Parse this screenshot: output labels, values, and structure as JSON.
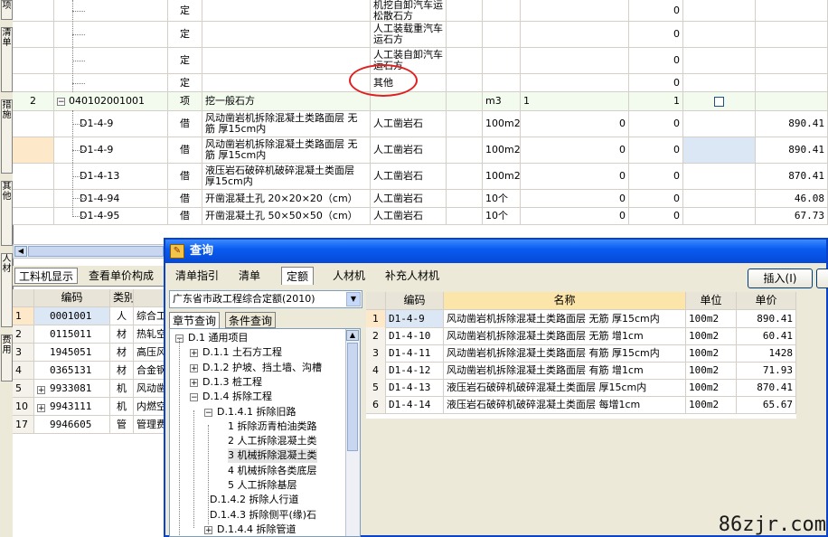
{
  "left_strip": {
    "tabs": [
      "项",
      "清",
      "单",
      "措",
      "施",
      "项",
      "目",
      "其",
      "他",
      "项",
      "目",
      "人",
      "材",
      "机",
      "汇",
      "总",
      "费",
      "用"
    ]
  },
  "main_grid": {
    "rows": [
      {
        "code": "",
        "type": "定",
        "name": "",
        "content": "机挖自卸汽车运松散石方",
        "unit": "",
        "qty": "",
        "c7": "",
        "c8": "0",
        "price": ""
      },
      {
        "code": "",
        "type": "定",
        "name": "",
        "content": "人工装载重汽车运石方",
        "unit": "",
        "qty": "",
        "c7": "",
        "c8": "0",
        "price": ""
      },
      {
        "code": "",
        "type": "定",
        "name": "",
        "content": "人工装自卸汽车运石方",
        "unit": "",
        "qty": "",
        "c7": "",
        "c8": "0",
        "price": ""
      },
      {
        "code": "",
        "type": "定",
        "name": "",
        "content": "其他",
        "unit": "",
        "qty": "",
        "c7": "",
        "c8": "0",
        "price": ""
      },
      {
        "no": "2",
        "code": "040102001001",
        "type": "项",
        "name": "挖一般石方",
        "content": "",
        "unit": "m3",
        "qty": "1",
        "c7": "",
        "c8": "1",
        "price": ""
      },
      {
        "code": "D1-4-9",
        "type": "借",
        "name": "风动凿岩机拆除混凝土类路面层 无筋 厚15cm内",
        "content": "人工凿岩石",
        "unit": "100m2",
        "qty": "",
        "c7": "0",
        "c8": "0",
        "price": "890.41"
      },
      {
        "code": "D1-4-9",
        "type": "借",
        "name": "风动凿岩机拆除混凝土类路面层 无筋 厚15cm内",
        "content": "人工凿岩石",
        "unit": "100m2",
        "qty": "",
        "c7": "0",
        "c8": "0",
        "price": "890.41"
      },
      {
        "code": "D1-4-13",
        "type": "借",
        "name": "液压岩石破碎机破碎混凝土类面层 厚15cm内",
        "content": "人工凿岩石",
        "unit": "100m2",
        "qty": "",
        "c7": "0",
        "c8": "0",
        "price": "870.41"
      },
      {
        "code": "D1-4-94",
        "type": "借",
        "name": "开凿混凝土孔 20×20×20（cm）",
        "content": "人工凿岩石",
        "unit": "10个",
        "qty": "",
        "c7": "0",
        "c8": "0",
        "price": "46.08"
      },
      {
        "code": "D1-4-95",
        "type": "借",
        "name": "开凿混凝土孔 50×50×50（cm）",
        "content": "人工凿岩石",
        "unit": "10个",
        "qty": "",
        "c7": "0",
        "c8": "0",
        "price": "67.73"
      }
    ],
    "tree_toggle": "−",
    "highlight_color": "#dbe7f5",
    "selected_row_color": "#fde9c9"
  },
  "annotation": {
    "color": "#e02020"
  },
  "bottom_left": {
    "tabs": [
      "工料机显示",
      "查看单价构成"
    ],
    "headers": [
      "编码",
      "类别",
      ""
    ],
    "rows": [
      {
        "no": "1",
        "code": "0001001",
        "cat": "人",
        "name": "综合工"
      },
      {
        "no": "2",
        "code": "0115011",
        "cat": "材",
        "name": "热轧空"
      },
      {
        "no": "3",
        "code": "1945051",
        "cat": "材",
        "name": "高压风"
      },
      {
        "no": "4",
        "code": "0365131",
        "cat": "材",
        "name": "合金钢"
      },
      {
        "no": "5",
        "code": "9933081",
        "cat": "机",
        "name": "风动凿",
        "expand": "+"
      },
      {
        "no": "10",
        "code": "9943111",
        "cat": "机",
        "name": "内燃空",
        "expand": "+"
      },
      {
        "no": "17",
        "code": "9946605",
        "cat": "管",
        "name": "管理费"
      }
    ]
  },
  "dialog": {
    "title": "查询",
    "icon_glyph": "✎",
    "tabs": [
      "清单指引",
      "清单",
      "定额",
      "人材机",
      "补充人材机"
    ],
    "active_tab": "定额",
    "insert_button": "插入(I)",
    "quota_library": "广东省市政工程综合定额(2010)",
    "search_tabs": [
      "章节查询",
      "条件查询"
    ],
    "tree": [
      {
        "level": 0,
        "box": "−",
        "label": "D.1 通用项目"
      },
      {
        "level": 1,
        "box": "+",
        "label": "D.1.1 土石方工程"
      },
      {
        "level": 1,
        "box": "+",
        "label": "D.1.2 护坡、挡土墙、沟槽"
      },
      {
        "level": 1,
        "box": "+",
        "label": "D.1.3 桩工程"
      },
      {
        "level": 1,
        "box": "−",
        "label": "D.1.4  拆除工程"
      },
      {
        "level": 2,
        "box": "−",
        "label": "D.1.4.1 拆除旧路"
      },
      {
        "level": 3,
        "box": "",
        "label": "1 拆除沥青柏油类路"
      },
      {
        "level": 3,
        "box": "",
        "label": "2 人工拆除混凝土类"
      },
      {
        "level": 3,
        "box": "",
        "label": "3 机械拆除混凝土类"
      },
      {
        "level": 3,
        "box": "",
        "label": "4 机械拆除各类底层"
      },
      {
        "level": 3,
        "box": "",
        "label": "5 人工拆除基层"
      },
      {
        "level": 2,
        "box": "",
        "label": "D.1.4.2 拆除人行道"
      },
      {
        "level": 2,
        "box": "",
        "label": "D.1.4.3 拆除侧平(缘)石"
      },
      {
        "level": 2,
        "box": "+",
        "label": "D.1.4.4 拆除管道"
      }
    ],
    "result_headers": [
      "",
      "编码",
      "名称",
      "单位",
      "单价"
    ],
    "results": [
      {
        "no": "1",
        "code": "D1-4-9",
        "name": "风动凿岩机拆除混凝土类路面层 无筋 厚15cm内",
        "unit": "100m2",
        "price": "890.41"
      },
      {
        "no": "2",
        "code": "D1-4-10",
        "name": "风动凿岩机拆除混凝土类路面层 无筋 增1cm",
        "unit": "100m2",
        "price": "60.41"
      },
      {
        "no": "3",
        "code": "D1-4-11",
        "name": "风动凿岩机拆除混凝土类路面层 有筋 厚15cm内",
        "unit": "100m2",
        "price": "1428"
      },
      {
        "no": "4",
        "code": "D1-4-12",
        "name": "风动凿岩机拆除混凝土类路面层 有筋 增1cm",
        "unit": "100m2",
        "price": "71.93"
      },
      {
        "no": "5",
        "code": "D1-4-13",
        "name": "液压岩石破碎机破碎混凝土类面层 厚15cm内",
        "unit": "100m2",
        "price": "870.41"
      },
      {
        "no": "6",
        "code": "D1-4-14",
        "name": "液压岩石破碎机破碎混凝土类面层 每增1cm",
        "unit": "100m2",
        "price": "65.67"
      }
    ],
    "title_bar_color": "#0a5cf0"
  },
  "watermark": "86zjr.com"
}
